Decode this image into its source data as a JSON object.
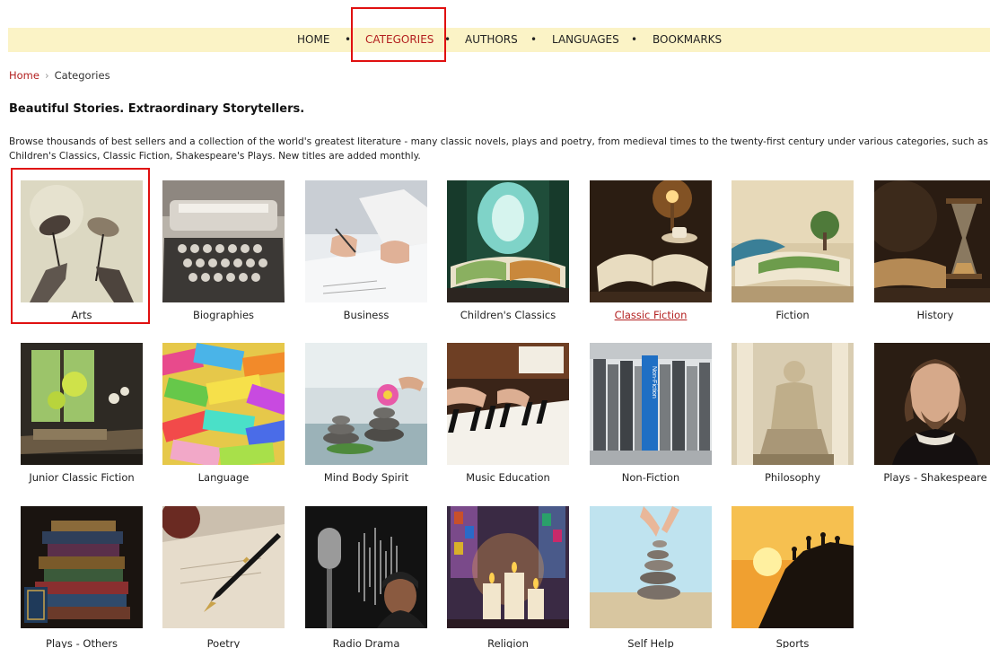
{
  "nav": {
    "items": [
      {
        "label": "HOME",
        "active": false
      },
      {
        "label": "CATEGORIES",
        "active": true
      },
      {
        "label": "AUTHORS",
        "active": false
      },
      {
        "label": "LANGUAGES",
        "active": false
      },
      {
        "label": "BOOKMARKS",
        "active": false
      }
    ],
    "separator": "•"
  },
  "breadcrumb": {
    "home": "Home",
    "separator": "›",
    "current": "Categories"
  },
  "page": {
    "title": "Beautiful Stories. Extraordinary Storytellers.",
    "intro": "Browse thousands of best sellers and a collection of the world's greatest literature - many classic novels, plays and poetry, from medieval times to the twenty-first century under various categories, such as Children's Classics, Classic Fiction, Shakespeare's Plays. New titles are added monthly."
  },
  "categories": [
    {
      "label": "Arts",
      "image": "theater-masks"
    },
    {
      "label": "Biographies",
      "image": "typewriter"
    },
    {
      "label": "Business",
      "image": "hands-writing"
    },
    {
      "label": "Children's Classics",
      "image": "enchanted-forest-book"
    },
    {
      "label": "Classic Fiction",
      "image": "open-book-lamp"
    },
    {
      "label": "Fiction",
      "image": "book-landscape"
    },
    {
      "label": "History",
      "image": "hourglass"
    },
    {
      "label": "Junior Classic Fiction",
      "image": "window-plant"
    },
    {
      "label": "Language",
      "image": "word-notes"
    },
    {
      "label": "Mind Body Spirit",
      "image": "stacked-stones-lotus"
    },
    {
      "label": "Music Education",
      "image": "piano"
    },
    {
      "label": "Non-Fiction",
      "image": "non-fiction-book",
      "spine_text": "Non-Fiction"
    },
    {
      "label": "Philosophy",
      "image": "statue"
    },
    {
      "label": "Plays - Shakespeare",
      "image": "shakespeare-portrait"
    },
    {
      "label": "Plays - Others",
      "image": "book-stack"
    },
    {
      "label": "Poetry",
      "image": "fountain-pen"
    },
    {
      "label": "Radio Drama",
      "image": "microphone"
    },
    {
      "label": "Religion",
      "image": "candles"
    },
    {
      "label": "Self Help",
      "image": "stacking-stones"
    },
    {
      "label": "Sports",
      "image": "climbers-sunset"
    }
  ],
  "state": {
    "hovered_category": "Classic Fiction"
  },
  "colors": {
    "nav_bg": "#fbf3c6",
    "accent": "#b32020",
    "highlight": "#e01010"
  }
}
